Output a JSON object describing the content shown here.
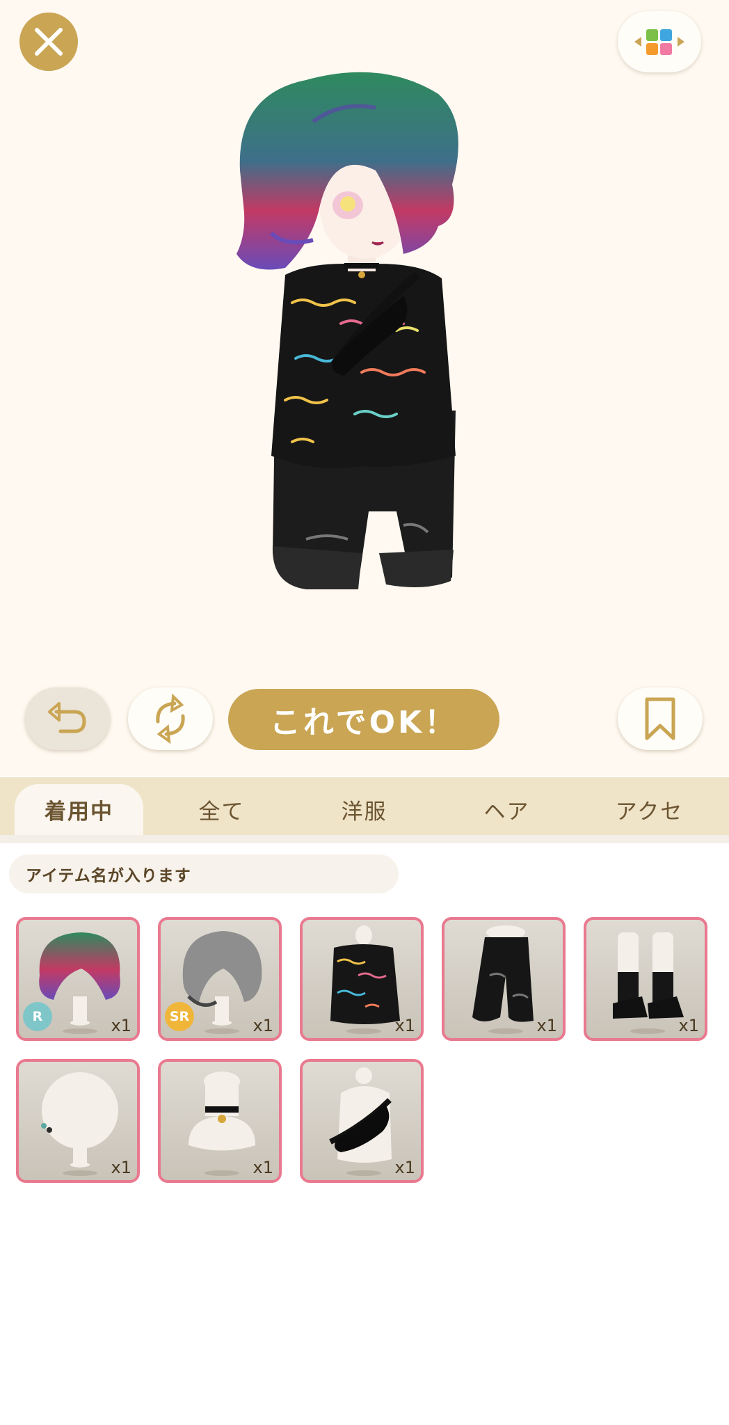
{
  "header": {
    "close_icon": "close-icon",
    "layout_icon": "color-grid-icon"
  },
  "controls": {
    "undo_icon": "undo-icon",
    "rotate_icon": "rotate-icon",
    "ok_label": "これでOK！",
    "save_icon": "bookmark-icon"
  },
  "tabs": [
    {
      "label": "着用中",
      "active": true
    },
    {
      "label": "全て",
      "active": false
    },
    {
      "label": "洋服",
      "active": false
    },
    {
      "label": "ヘア",
      "active": false
    },
    {
      "label": "アクセ",
      "active": false
    }
  ],
  "search": {
    "placeholder": "アイテム名が入ります"
  },
  "items": [
    {
      "kind": "hair-gradient",
      "count": "x1",
      "rarity": "R",
      "rarity_color": "#7fc6c8"
    },
    {
      "kind": "hair-gray",
      "count": "x1",
      "rarity": "SR",
      "rarity_color": "#f0b63a"
    },
    {
      "kind": "sweater",
      "count": "x1"
    },
    {
      "kind": "pants",
      "count": "x1"
    },
    {
      "kind": "shoes",
      "count": "x1"
    },
    {
      "kind": "earring",
      "count": "x1"
    },
    {
      "kind": "choker",
      "count": "x1"
    },
    {
      "kind": "bag",
      "count": "x1"
    }
  ],
  "colors": {
    "accent": "#c9a554",
    "item_border": "#e9798f",
    "tab_bar": "#efe3c8",
    "background": "#fff9f1"
  }
}
